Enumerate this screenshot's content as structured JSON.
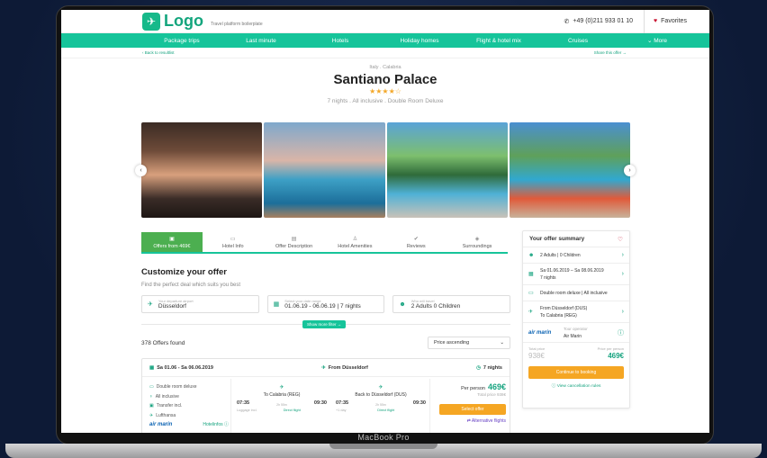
{
  "device": {
    "label": "MacBook Pro"
  },
  "header": {
    "logo_text": "Logo",
    "tagline": "Travel platform boilerplate",
    "phone": "+49 (0)211 933 01 10",
    "favorites": "Favorites"
  },
  "nav": {
    "items": [
      "Package trips",
      "Last minute",
      "Hotels",
      "Holiday homes",
      "Flight & hotel mix",
      "Cruises",
      "More"
    ]
  },
  "subbar": {
    "back": "Back to resultlist",
    "share": "Share this offer"
  },
  "hotel": {
    "location": "Italy . Calabria",
    "name": "Santiano Palace",
    "stars": "★★★★☆",
    "meta": "7 nights . All inclusive . Double Room Deluxe"
  },
  "tabs": [
    {
      "label": "Offers from 469€",
      "icon": "suitcase-icon"
    },
    {
      "label": "Hotel Info",
      "icon": "bed-icon"
    },
    {
      "label": "Offer Description",
      "icon": "document-icon"
    },
    {
      "label": "Hotel Amenities",
      "icon": "person-icon"
    },
    {
      "label": "Reviews",
      "icon": "thumbs-up-icon"
    },
    {
      "label": "Surroundings",
      "icon": "compass-icon"
    }
  ],
  "customize": {
    "title": "Customize your offer",
    "subtitle": "Find the perfect deal which suits you best",
    "fields": [
      {
        "label": "Your departure airport",
        "value": "Düsseldorf"
      },
      {
        "label": "Select your date range",
        "value": "01.06.19 - 06.06.19 | 7 nights"
      },
      {
        "label": "Who will travel",
        "value": "2 Adults  0 Children"
      }
    ],
    "more_filter": "Show more filter"
  },
  "results": {
    "count": "378 Offers found",
    "sort": "Price ascending"
  },
  "offer": {
    "dates": "Sa 01.06 - Sa 06.06.2019",
    "from": "From Düsseldorf",
    "nights": "7 nights",
    "features": [
      "Double room deluxe",
      "All inclusive",
      "Transfer incl.",
      "Lufthansa"
    ],
    "airline": "air marin",
    "hotelinfos": "Hotelinfos",
    "outbound": {
      "dest": "To Calabria (REG)",
      "dep": "07:35",
      "arr": "09:30",
      "dur": "2h 55m",
      "lug": "Luggage incl.",
      "direct": "Direct flight",
      "extra": ""
    },
    "inbound": {
      "dest": "Back to Düsseldorf (DUS)",
      "dep": "07:35",
      "arr": "09:30",
      "dur": "2h 55m",
      "lug": "Luggage incl.",
      "direct": "Direct flight",
      "extra": "+1 day"
    },
    "per_person_label": "Per person",
    "per_person": "469€",
    "total": "Total price 938€",
    "select": "Select offer",
    "alt": "Alternative flights"
  },
  "summary": {
    "title": "Your offer summary",
    "travellers": "2 Adults | 0 Children",
    "dates_1": "Sa 01.06.2019 – Sa 08.06.2019",
    "dates_2": "7 nights",
    "room": "Double room deluxe | All inclusive",
    "route_1": "From Düsseldorf (DUS)",
    "route_2": "To Calabria (REG)",
    "operator_label": "Tour operator",
    "operator": "Air Marin",
    "total_label": "Total price",
    "total": "938€",
    "pp_label": "Price per person",
    "pp": "469€",
    "continue": "Continue to booking",
    "cancel": "View cancellation rules"
  },
  "colors": {
    "accent": "#16c49a",
    "accent_dark": "#16a37f",
    "cta": "#f5a623",
    "active_tab": "#4caf50"
  }
}
